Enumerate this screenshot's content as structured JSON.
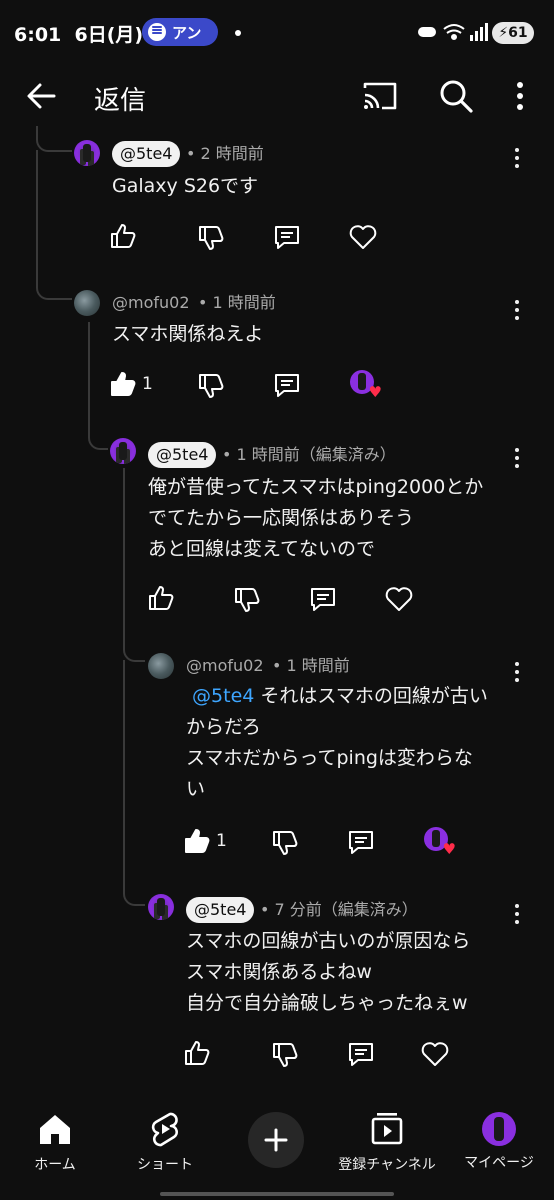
{
  "status_bar": {
    "time": "6:01",
    "date": "6日(月)",
    "notification": "アン",
    "battery": "61"
  },
  "header": {
    "title": "返信",
    "back_icon": "arrow-left-icon",
    "cast_icon": "cast-icon",
    "search_icon": "search-icon",
    "more_icon": "more-vert-icon"
  },
  "comments": [
    {
      "author": "@5te4",
      "author_style": "chip",
      "meta": "• 2 時間前",
      "lines": [
        "Galaxy S26です"
      ],
      "likes": "",
      "hearted": false
    },
    {
      "author": "@mofu02",
      "author_style": "plain",
      "meta": "• 1 時間前",
      "lines": [
        "スマホ関係ねえよ"
      ],
      "likes": "1",
      "hearted": true
    },
    {
      "author": "@5te4",
      "author_style": "chip",
      "meta": "• 1 時間前（編集済み）",
      "lines": [
        "俺が昔使ってたスマホはping2000とか",
        "でてたから一応関係はありそう",
        "あと回線は変えてないので"
      ],
      "likes": "",
      "hearted": false
    },
    {
      "author": "@mofu02",
      "author_style": "plain",
      "meta": "• 1 時間前",
      "mention": "@5te4",
      "lines": [
        "それはスマホの回線が古い",
        "からだろ",
        "スマホだからってpingは変わらな",
        "い"
      ],
      "likes": "1",
      "hearted": true
    },
    {
      "author": "@5te4",
      "author_style": "chip",
      "meta": "• 7 分前（編集済み）",
      "lines": [
        "スマホの回線が古いのが原因なら",
        "スマホ関係あるよねw",
        "自分で自分論破しちゃったねぇw"
      ],
      "likes": "",
      "hearted": false
    }
  ],
  "bottom_nav": {
    "home": "ホーム",
    "shorts": "ショート",
    "subscriptions": "登録チャンネル",
    "you": "マイページ"
  }
}
